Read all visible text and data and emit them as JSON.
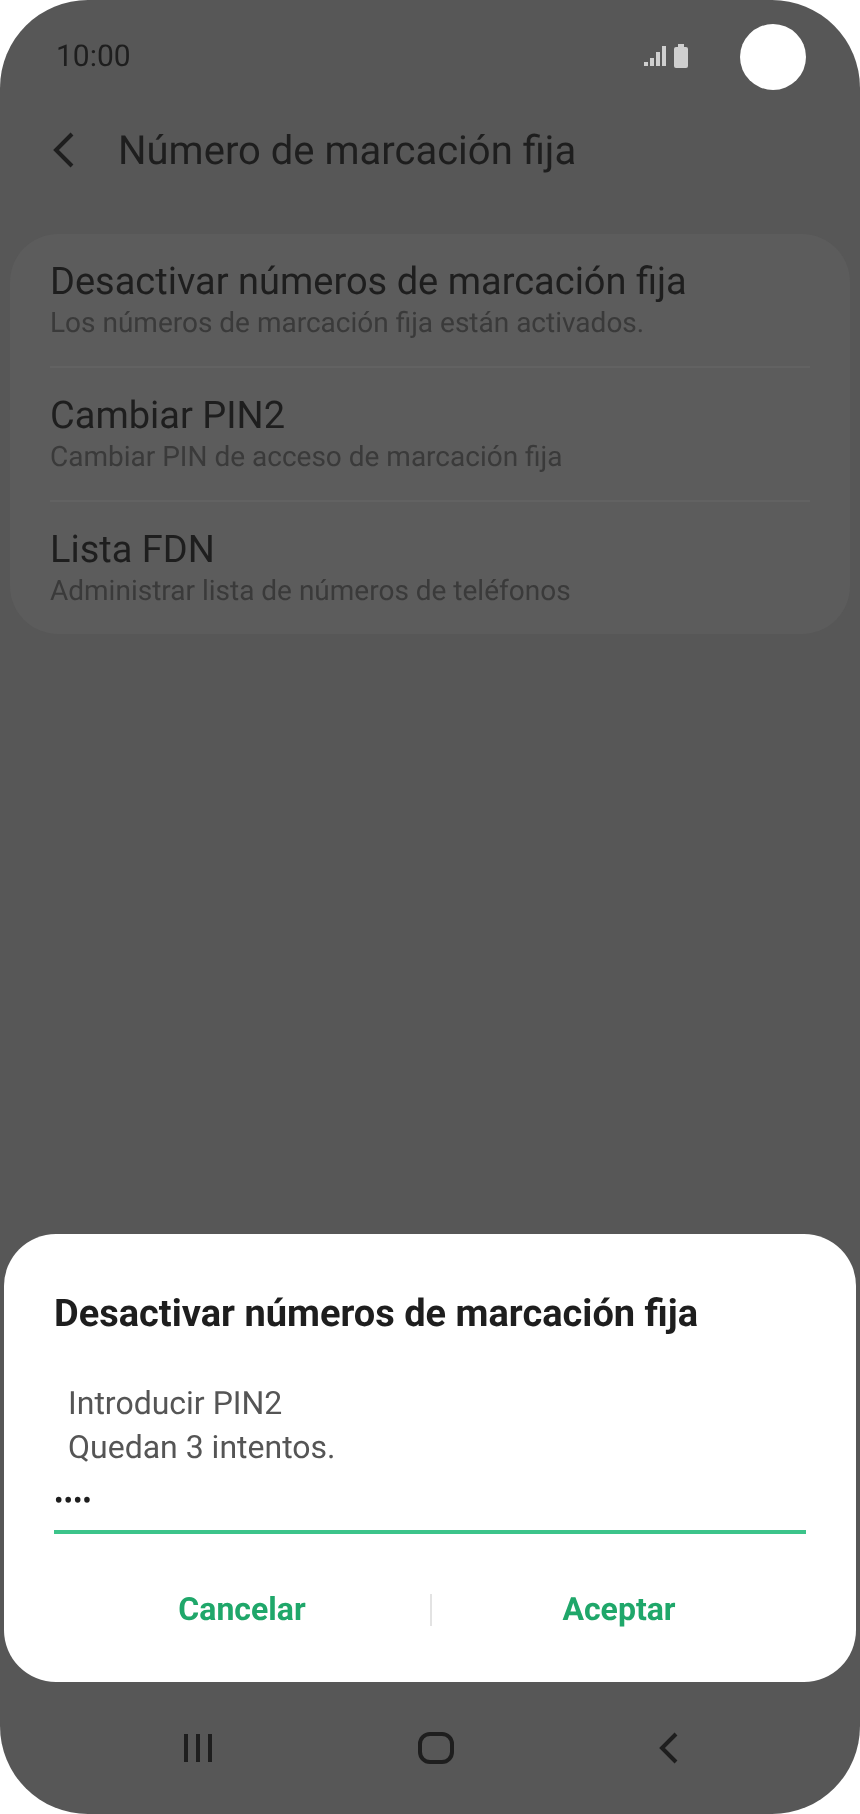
{
  "status_bar": {
    "time": "10:00"
  },
  "header": {
    "title": "Número de marcación fija"
  },
  "settings": [
    {
      "title": "Desactivar números de marcación fija",
      "subtitle": "Los números de marcación fija están activados."
    },
    {
      "title": "Cambiar PIN2",
      "subtitle": "Cambiar PIN de acceso de marcación fija"
    },
    {
      "title": "Lista FDN",
      "subtitle": "Administrar lista de números de teléfonos"
    }
  ],
  "dialog": {
    "title": "Desactivar números de marcación fija",
    "message_lines": [
      "Introducir PIN2",
      "Quedan 3 intentos."
    ],
    "pin_value": "••••",
    "buttons": [
      "Cancelar",
      "Aceptar"
    ]
  }
}
